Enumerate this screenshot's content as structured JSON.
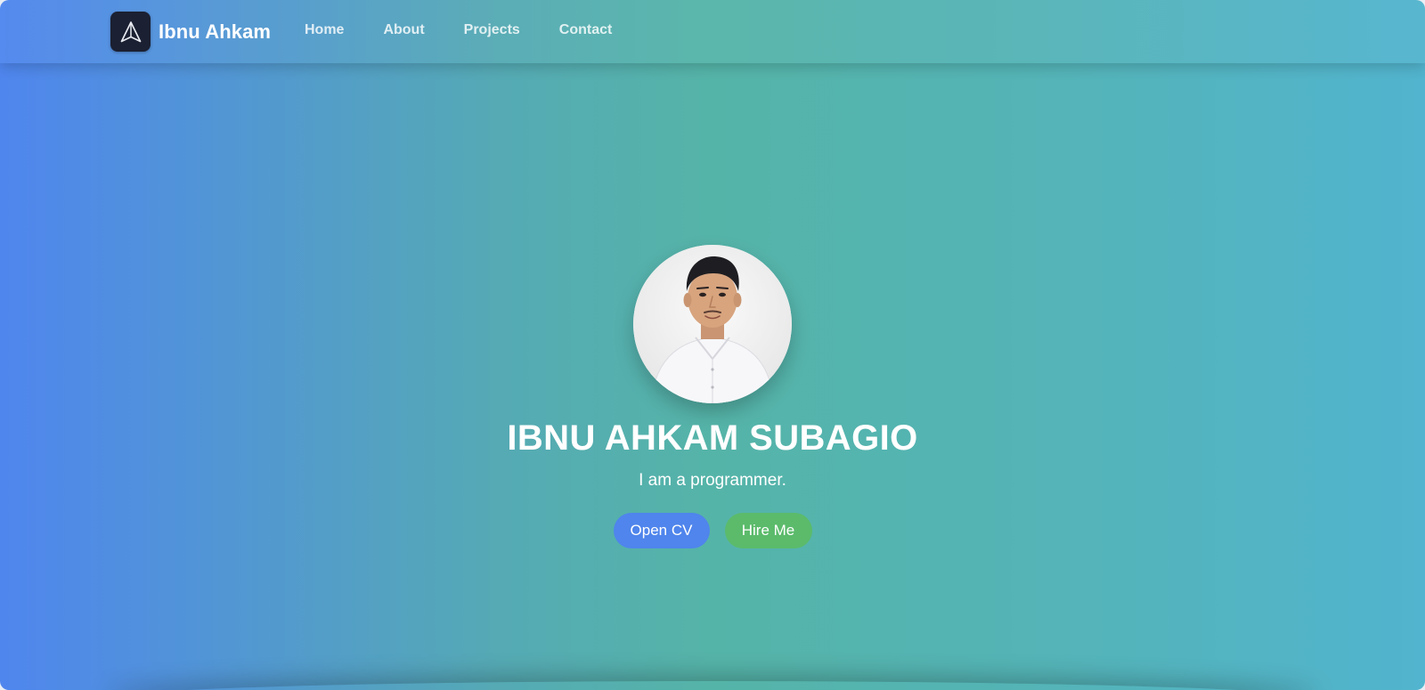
{
  "brand": {
    "name": "Ibnu Ahkam",
    "logo_icon": "paper-plane-icon"
  },
  "nav": {
    "items": [
      {
        "label": "Home"
      },
      {
        "label": "About"
      },
      {
        "label": "Projects"
      },
      {
        "label": "Contact"
      }
    ]
  },
  "hero": {
    "avatar_icon": "profile-photo",
    "title": "IBNU AHKAM SUBAGIO",
    "subtitle": "I am a programmer.",
    "buttons": {
      "cv_label": "Open CV",
      "hire_label": "Hire Me"
    }
  },
  "colors": {
    "gradient_start": "#4f86ee",
    "gradient_mid": "#55b4a8",
    "gradient_end": "#52b4ce",
    "cv_button": "#4f85ec",
    "hire_button": "#5bbb6b",
    "logo_bg": "#1b2032"
  }
}
